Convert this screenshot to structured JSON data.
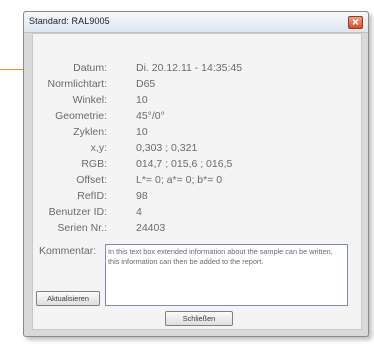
{
  "window": {
    "title": "Standard: RAL9005"
  },
  "fields": [
    {
      "label": "Datum:",
      "value": "Di. 20.12.11 - 14:35:45"
    },
    {
      "label": "Normlichtart:",
      "value": "D65"
    },
    {
      "label": "Winkel:",
      "value": "10"
    },
    {
      "label": "Geometrie:",
      "value": "45°/0°"
    },
    {
      "label": "Zyklen:",
      "value": "10"
    },
    {
      "label": "x,y:",
      "value": "0,303 ; 0,321"
    },
    {
      "label": "RGB:",
      "value": "014,7 ; 015,6 ; 016,5"
    },
    {
      "label": "Offset:",
      "value": "L*= 0; a*= 0; b*= 0"
    },
    {
      "label": "RefID:",
      "value": "98"
    },
    {
      "label": "Benutzer ID:",
      "value": "4"
    },
    {
      "label": "Serien Nr.:",
      "value": "24403"
    }
  ],
  "comment": {
    "label": "Kommentar:",
    "text": "In this text box extended information about the sample can be written, this information can then be added to the report."
  },
  "buttons": {
    "update": "Aktualisieren",
    "close": "Schließen"
  }
}
